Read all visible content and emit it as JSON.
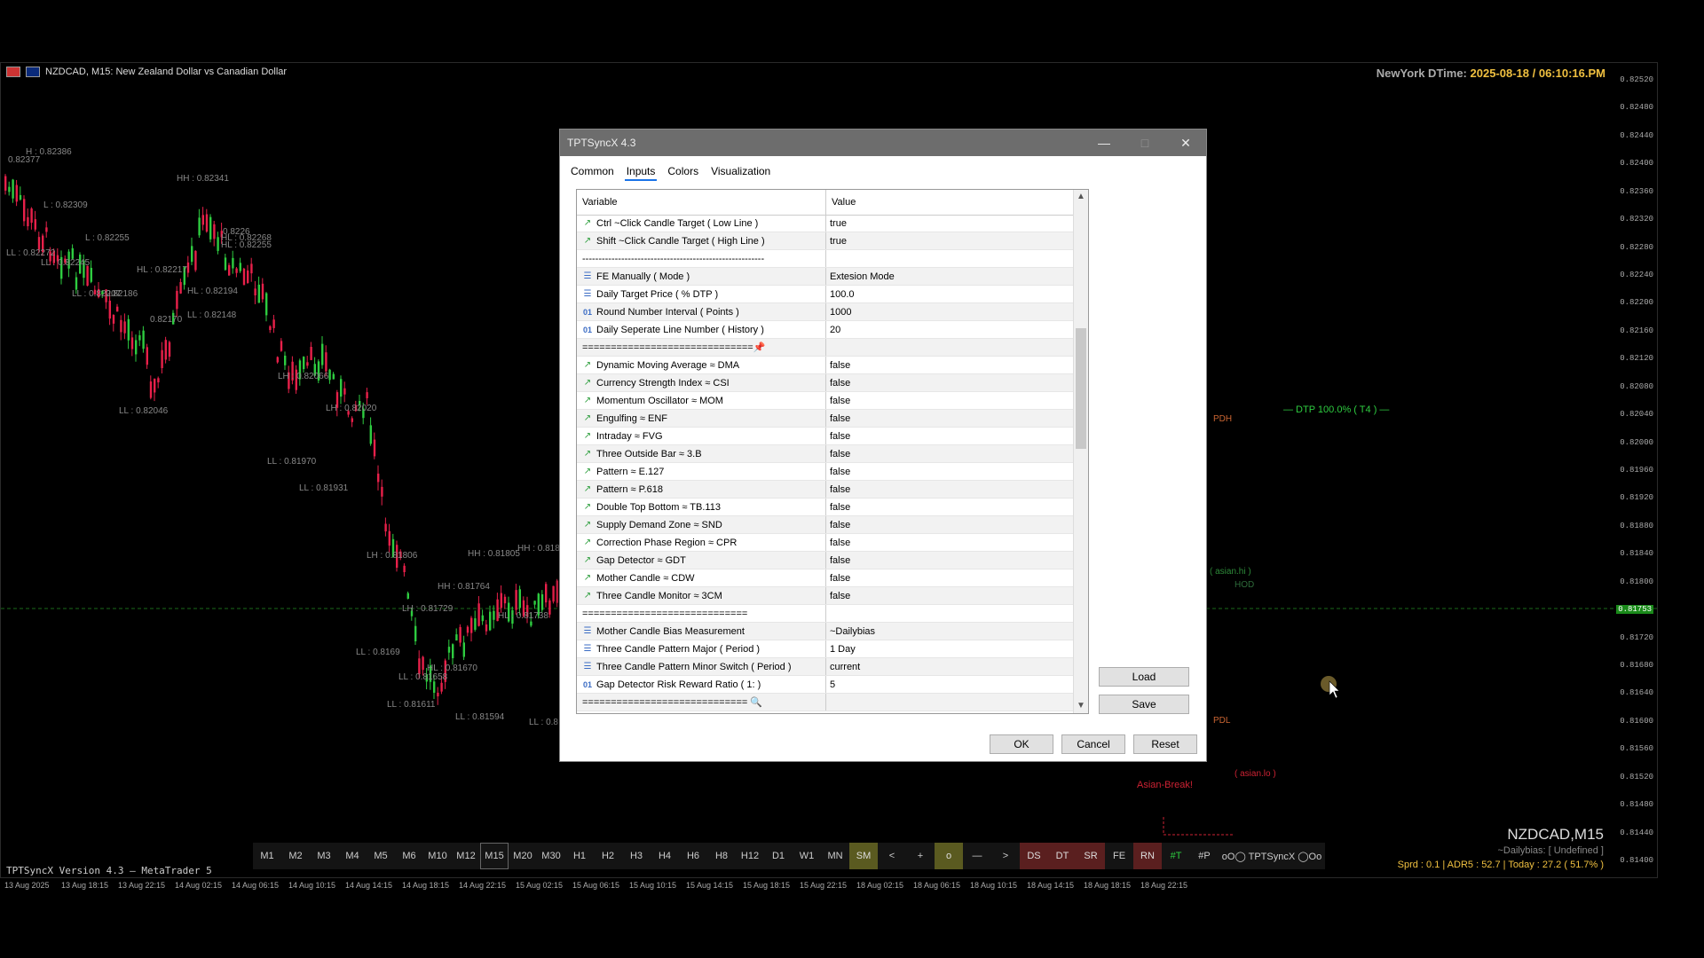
{
  "chart": {
    "symbol_title": "NZDCAD, M15:  New Zealand Dollar vs Canadian Dollar",
    "ny_label": "NewYork DTime:",
    "ny_value": "2025-08-18 / 06:10:16.PM",
    "footer_left": "TPTSyncX Version 4.3 — MetaTrader 5",
    "symbol_big": "NZDCAD,M15",
    "bias": "~Dailybias: [ Undefined ]",
    "stats": "Sprd : 0.1 | ADR5 : 52.7 | Today : 27.2 ( 51.7% )",
    "dtp_label": "— DTP 100.0% ( T4 ) —",
    "pdh": "PDH",
    "pdl": "PDL",
    "hod": "HOD",
    "asian_hi": "( asian.hi )",
    "asian_lo": "( asian.lo )",
    "asian_break": "Asian-Break!",
    "current_price_tag": "0.81753",
    "price_axis": [
      "0.82520",
      "0.82480",
      "0.82440",
      "0.82400",
      "0.82360",
      "0.82320",
      "0.82280",
      "0.82240",
      "0.82200",
      "0.82160",
      "0.82120",
      "0.82080",
      "0.82040",
      "0.82000",
      "0.81960",
      "0.81920",
      "0.81880",
      "0.81840",
      "0.81800",
      "0.81760",
      "0.81720",
      "0.81680",
      "0.81640",
      "0.81600",
      "0.81560",
      "0.81520",
      "0.81480",
      "0.81440",
      "0.81400"
    ],
    "time_axis": [
      "13 Aug 2025",
      "13 Aug 18:15",
      "13 Aug 22:15",
      "14 Aug 02:15",
      "14 Aug 06:15",
      "14 Aug 10:15",
      "14 Aug 14:15",
      "14 Aug 18:15",
      "14 Aug 22:15",
      "15 Aug 02:15",
      "15 Aug 06:15",
      "15 Aug 10:15",
      "15 Aug 14:15",
      "15 Aug 18:15",
      "15 Aug 22:15",
      "18 Aug 02:15",
      "18 Aug 06:15",
      "18 Aug 10:15",
      "18 Aug 14:15",
      "18 Aug 18:15",
      "18 Aug 22:15"
    ],
    "swing_labels": [
      "H : 0.82386",
      "0.82377",
      "HH : 0.82341",
      "L : 0.82309",
      "0.8226",
      "HL : 0.82268",
      "L : 0.82255",
      "HL : 0.82255",
      "LL : 0.82272",
      "LL : 0.82245",
      "HL : 0.82217",
      "HL : 0.82194",
      "LL : 0.82207",
      "0.82186",
      "0.82170",
      "LL : 0.82148",
      "LL : 0.82046",
      "LH : 0.82066",
      "LH : 0.82020",
      "LL : 0.81970",
      "LL : 0.81931",
      "LH : 0.81806",
      "HH : 0.81805",
      "HH : 0.81764",
      "LH : 0.81729",
      "HL : 0.81738",
      "LL : 0.8169",
      "HL : 0.81670",
      "LL : 0.81658",
      "LL : 0.81611",
      "LL : 0.81594",
      "HH : 0.818",
      "LL : 0.8"
    ]
  },
  "dialog": {
    "title": "TPTSyncX 4.3",
    "tabs": [
      "Common",
      "Inputs",
      "Colors",
      "Visualization"
    ],
    "col_variable": "Variable",
    "col_value": "Value",
    "rows": [
      {
        "icon": "bool",
        "var": "Ctrl ~Click Candle Target ( Low Line )",
        "val": "true"
      },
      {
        "icon": "bool",
        "var": "Shift ~Click Candle Target ( High Line )",
        "val": "true"
      },
      {
        "icon": "none",
        "var": "--------------------------------------------------------",
        "val": ""
      },
      {
        "icon": "enum",
        "var": "FE Manually ( Mode )",
        "val": "Extesion Mode"
      },
      {
        "icon": "enum",
        "var": "Daily Target Price ( % DTP )",
        "val": "100.0"
      },
      {
        "icon": "int",
        "var": "Round Number Interval ( Points )",
        "val": "1000"
      },
      {
        "icon": "int",
        "var": "Daily Seperate Line Number ( History )",
        "val": "20"
      },
      {
        "icon": "none",
        "var": "==============================📌",
        "val": ""
      },
      {
        "icon": "bool",
        "var": "Dynamic Moving Average ≈ DMA",
        "val": "false"
      },
      {
        "icon": "bool",
        "var": "Currency Strength Index ≈ CSI",
        "val": "false"
      },
      {
        "icon": "bool",
        "var": "Momentum Oscillator ≈ MOM",
        "val": "false"
      },
      {
        "icon": "bool",
        "var": "Engulfing ≈ ENF",
        "val": "false"
      },
      {
        "icon": "bool",
        "var": "Intraday ≈ FVG",
        "val": "false"
      },
      {
        "icon": "bool",
        "var": "Three Outside Bar ≈ 3.B",
        "val": "false"
      },
      {
        "icon": "bool",
        "var": "Pattern ≈ E.127",
        "val": "false"
      },
      {
        "icon": "bool",
        "var": "Pattern ≈ P.618",
        "val": "false"
      },
      {
        "icon": "bool",
        "var": "Double Top Bottom ≈ TB.113",
        "val": "false"
      },
      {
        "icon": "bool",
        "var": "Supply Demand Zone ≈ SND",
        "val": "false"
      },
      {
        "icon": "bool",
        "var": "Correction Phase Region ≈ CPR",
        "val": "false"
      },
      {
        "icon": "bool",
        "var": "Gap Detector ≈ GDT",
        "val": "false"
      },
      {
        "icon": "bool",
        "var": "Mother Candle ≈ CDW",
        "val": "false"
      },
      {
        "icon": "bool",
        "var": "Three Candle Monitor ≈ 3CM",
        "val": "false"
      },
      {
        "icon": "none",
        "var": "=============================",
        "val": ""
      },
      {
        "icon": "enum",
        "var": "Mother Candle Bias Measurement",
        "val": "~Dailybias"
      },
      {
        "icon": "enum",
        "var": "Three Candle Pattern Major ( Period )",
        "val": "1 Day"
      },
      {
        "icon": "enum",
        "var": "Three Candle Pattern Minor Switch ( Period )",
        "val": "current"
      },
      {
        "icon": "int",
        "var": "Gap Detector Risk Reward Ratio ( 1: )",
        "val": "5"
      },
      {
        "icon": "none",
        "var": "============================= 🔍",
        "val": ""
      }
    ],
    "btn_load": "Load",
    "btn_save": "Save",
    "btn_ok": "OK",
    "btn_cancel": "Cancel",
    "btn_reset": "Reset"
  },
  "toolbar": {
    "items": [
      {
        "label": "M1",
        "style": ""
      },
      {
        "label": "M2",
        "style": ""
      },
      {
        "label": "M3",
        "style": ""
      },
      {
        "label": "M4",
        "style": ""
      },
      {
        "label": "M5",
        "style": ""
      },
      {
        "label": "M6",
        "style": ""
      },
      {
        "label": "M10",
        "style": ""
      },
      {
        "label": "M12",
        "style": ""
      },
      {
        "label": "M15",
        "style": "active"
      },
      {
        "label": "M20",
        "style": ""
      },
      {
        "label": "M30",
        "style": ""
      },
      {
        "label": "H1",
        "style": ""
      },
      {
        "label": "H2",
        "style": ""
      },
      {
        "label": "H3",
        "style": ""
      },
      {
        "label": "H4",
        "style": ""
      },
      {
        "label": "H6",
        "style": ""
      },
      {
        "label": "H8",
        "style": ""
      },
      {
        "label": "H12",
        "style": ""
      },
      {
        "label": "D1",
        "style": ""
      },
      {
        "label": "W1",
        "style": ""
      },
      {
        "label": "MN",
        "style": ""
      },
      {
        "label": "SM",
        "style": "olive"
      },
      {
        "label": "<",
        "style": ""
      },
      {
        "label": "+",
        "style": ""
      },
      {
        "label": "o",
        "style": "olive"
      },
      {
        "label": "—",
        "style": ""
      },
      {
        "label": ">",
        "style": ""
      },
      {
        "label": "DS",
        "style": "red"
      },
      {
        "label": "DT",
        "style": "red"
      },
      {
        "label": "SR",
        "style": "red"
      },
      {
        "label": "FE",
        "style": ""
      },
      {
        "label": "RN",
        "style": "red"
      },
      {
        "label": "#T",
        "style": "green"
      },
      {
        "label": "#P",
        "style": ""
      },
      {
        "label": "oO◯ TPTSyncX ◯Oo",
        "style": "wide"
      }
    ]
  },
  "colors": {
    "bull": "#2ecc40",
    "bear": "#e8204a",
    "accent_green": "#00cc00",
    "accent_red": "#cc2233",
    "pdh": "#cc6633"
  }
}
